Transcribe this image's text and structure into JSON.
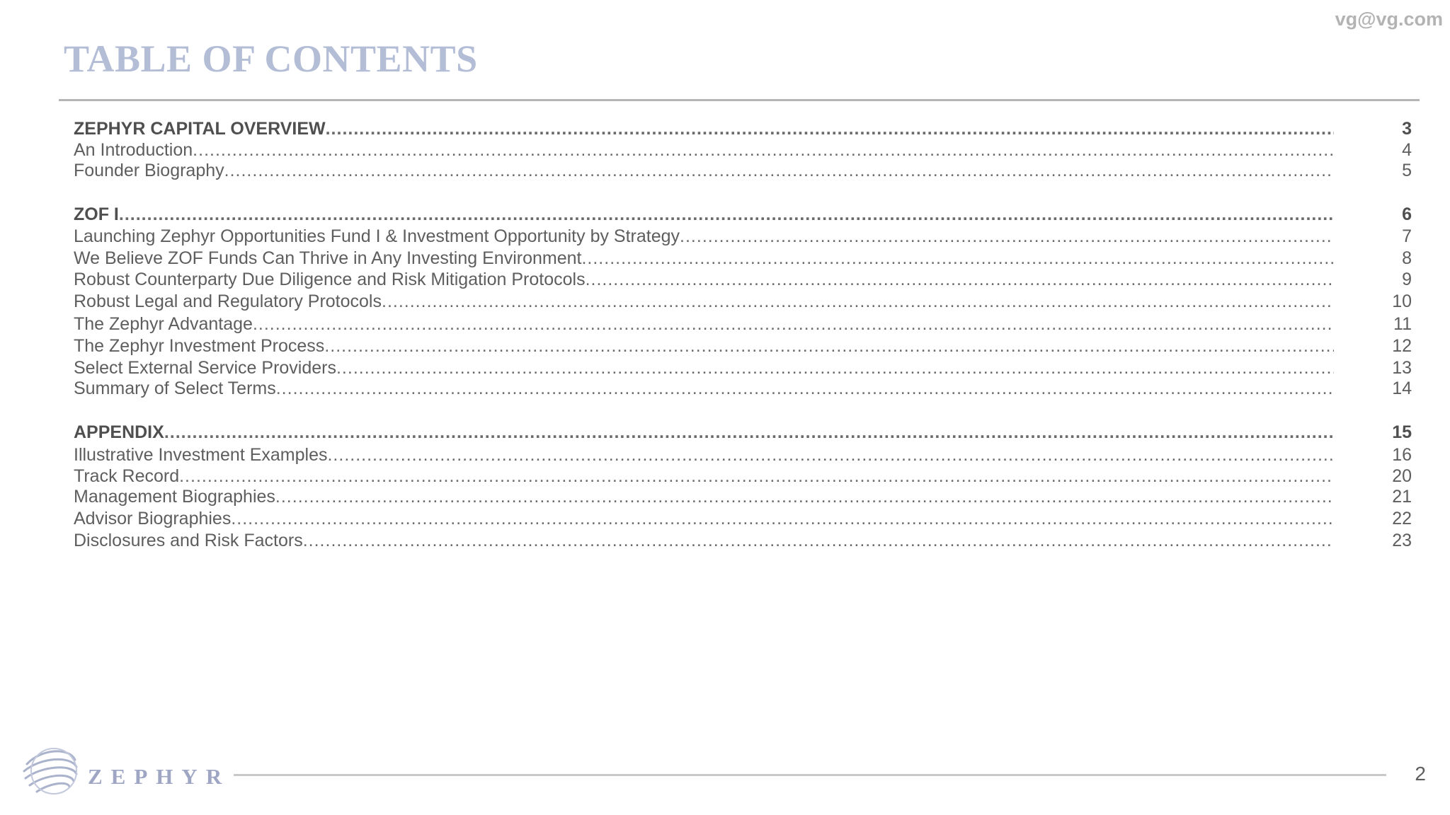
{
  "header": {
    "email": "vg@vg.com",
    "title": "TABLE OF CONTENTS"
  },
  "toc": [
    {
      "label": "ZEPHYR CAPITAL OVERVIEW",
      "page": "3",
      "section": true
    },
    {
      "label": "An Introduction",
      "page": "4",
      "section": false
    },
    {
      "label": "Founder Biography",
      "page": "5",
      "section": false
    },
    {
      "label": "ZOF I",
      "page": "6",
      "section": true
    },
    {
      "label": "Launching Zephyr Opportunities Fund I & Investment Opportunity by Strategy",
      "page": "7",
      "section": false
    },
    {
      "label": "We Believe ZOF Funds Can Thrive in Any Investing Environment",
      "page": "8",
      "section": false
    },
    {
      "label": "Robust Counterparty Due Diligence and Risk Mitigation Protocols",
      "page": "9",
      "section": false
    },
    {
      "label": "Robust Legal and Regulatory Protocols",
      "page": "10",
      "section": false
    },
    {
      "label": "The Zephyr Advantage",
      "page": "11",
      "section": false
    },
    {
      "label": "The Zephyr Investment Process",
      "page": "12",
      "section": false
    },
    {
      "label": "Select External Service Providers",
      "page": "13",
      "section": false
    },
    {
      "label": "Summary of Select Terms",
      "page": "14",
      "section": false
    },
    {
      "label": "APPENDIX",
      "page": "15",
      "section": true
    },
    {
      "label": "Illustrative Investment Examples",
      "page": "16",
      "section": false
    },
    {
      "label": "Track Record",
      "page": "20",
      "section": false
    },
    {
      "label": "Management Biographies",
      "page": "21",
      "section": false
    },
    {
      "label": "Advisor Biographies",
      "page": "22",
      "section": false
    },
    {
      "label": "Disclosures and Risk Factors",
      "page": "23",
      "section": false
    }
  ],
  "footer": {
    "brand": "ZEPHYR",
    "logo_icon": "wind-swirl-icon",
    "page_number": "2"
  },
  "colors": {
    "title": "#b4bdd6",
    "brand": "#9ea6c4",
    "text": "#5e5e5e",
    "rule": "#b5b5b5"
  }
}
